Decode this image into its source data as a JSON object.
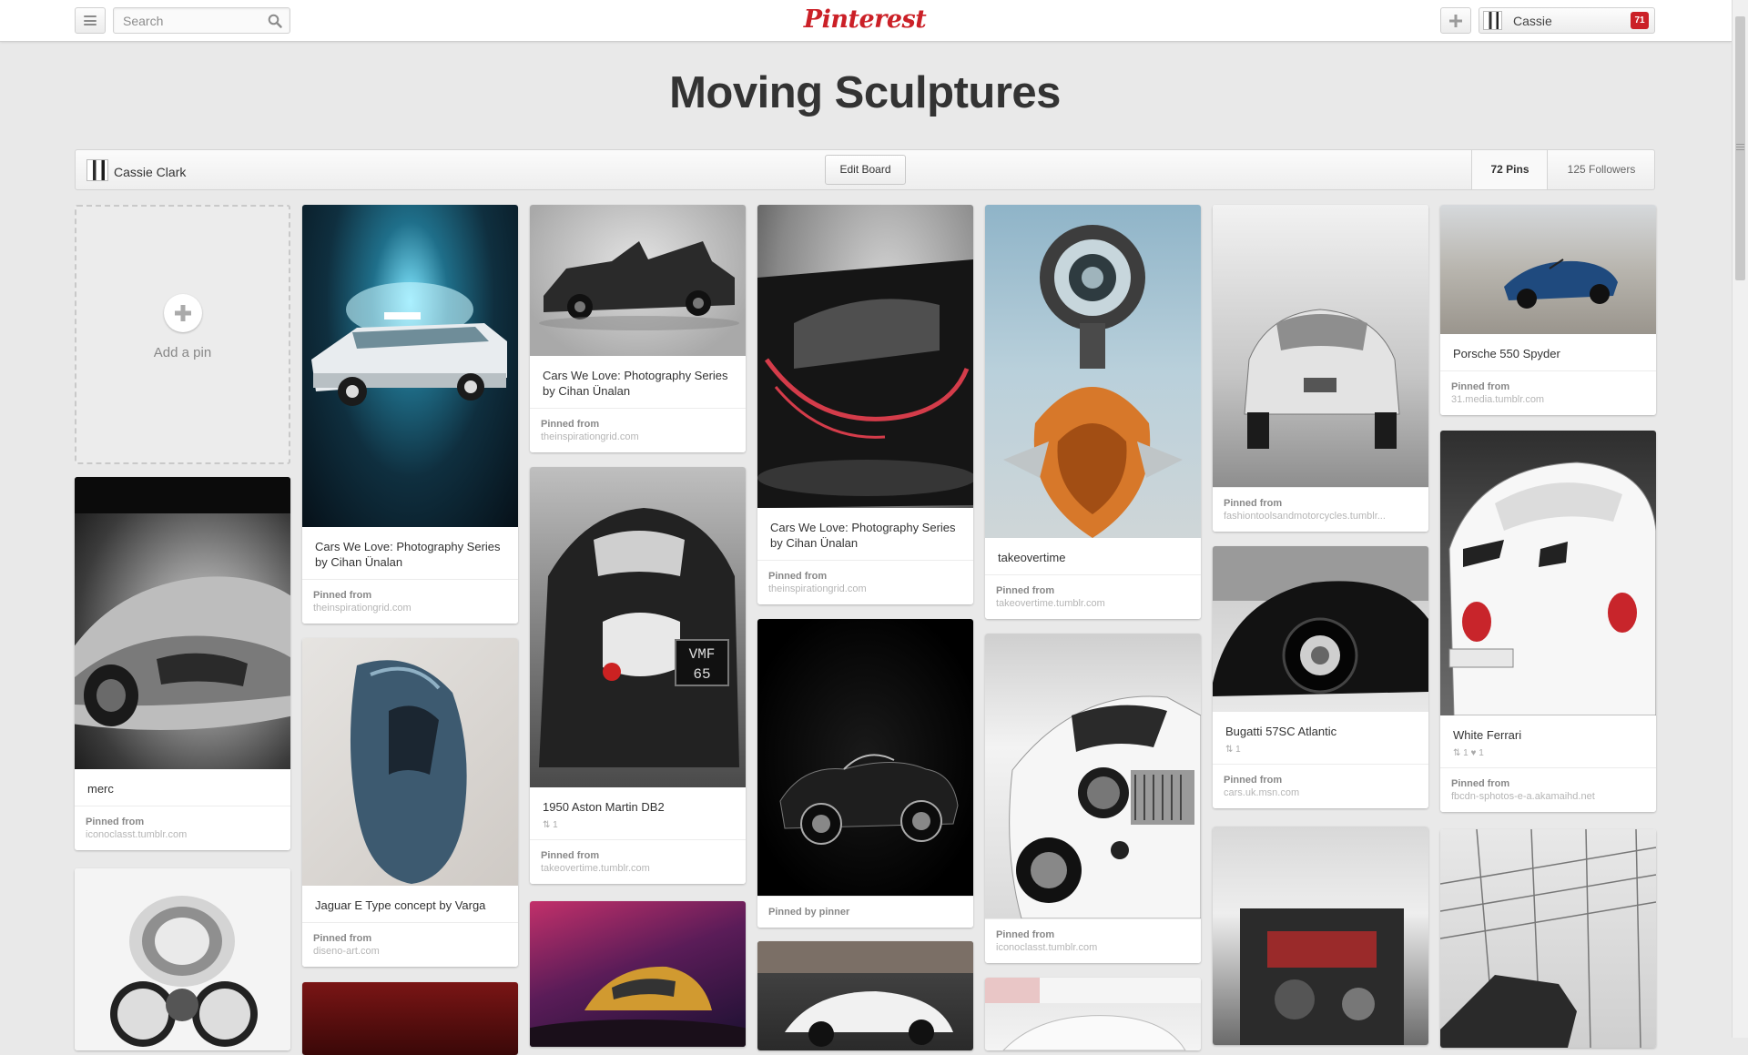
{
  "header": {
    "search_placeholder": "Search",
    "logo_text": "Pinterest",
    "user_name": "Cassie",
    "notification_count": "71",
    "accent_color": "#cb2027"
  },
  "board": {
    "title": "Moving Sculptures",
    "owner": "Cassie Clark",
    "edit_label": "Edit Board",
    "pins_count": "72 Pins",
    "followers_count": "125 Followers"
  },
  "add_pin_label": "Add a pin",
  "pins": [
    {
      "desc": "merc",
      "stats": "",
      "source_label": "Pinned from",
      "source": "iconoclasst.tumblr.com"
    },
    {
      "desc": "Cars We Love: Photography Series by Cihan Ünalan",
      "stats": "",
      "source_label": "Pinned from",
      "source": "theinspirationgrid.com"
    },
    {
      "desc": "Jaguar E Type concept by Varga",
      "stats": "",
      "source_label": "Pinned from",
      "source": "diseno-art.com"
    },
    {
      "desc": "Cars We Love: Photography Series by Cihan Ünalan",
      "stats": "",
      "source_label": "Pinned from",
      "source": "theinspirationgrid.com"
    },
    {
      "desc": "1950 Aston Martin DB2",
      "stats": "⇅ 1",
      "source_label": "Pinned from",
      "source": "takeovertime.tumblr.com"
    },
    {
      "desc": "Cars We Love: Photography Series by Cihan Ünalan",
      "stats": "",
      "source_label": "Pinned from",
      "source": "theinspirationgrid.com"
    },
    {
      "desc": "",
      "stats": "",
      "source_label": "Pinned by pinner",
      "source": ""
    },
    {
      "desc": "takeovertime",
      "stats": "",
      "source_label": "Pinned from",
      "source": "takeovertime.tumblr.com"
    },
    {
      "desc": "",
      "stats": "",
      "source_label": "Pinned from",
      "source": "iconoclasst.tumblr.com"
    },
    {
      "desc": "",
      "stats": "",
      "source_label": "Pinned from",
      "source": "fashiontoolsandmotorcycles.tumblr..."
    },
    {
      "desc": "Bugatti 57SC Atlantic",
      "stats": "⇅ 1",
      "source_label": "Pinned from",
      "source": "cars.uk.msn.com"
    },
    {
      "desc": "Porsche 550 Spyder",
      "stats": "",
      "source_label": "Pinned from",
      "source": "31.media.tumblr.com"
    },
    {
      "desc": "White Ferrari",
      "stats": "⇅ 1   ♥ 1",
      "source_label": "Pinned from",
      "source": "fbcdn-sphotos-e-a.akamaihd.net"
    }
  ]
}
